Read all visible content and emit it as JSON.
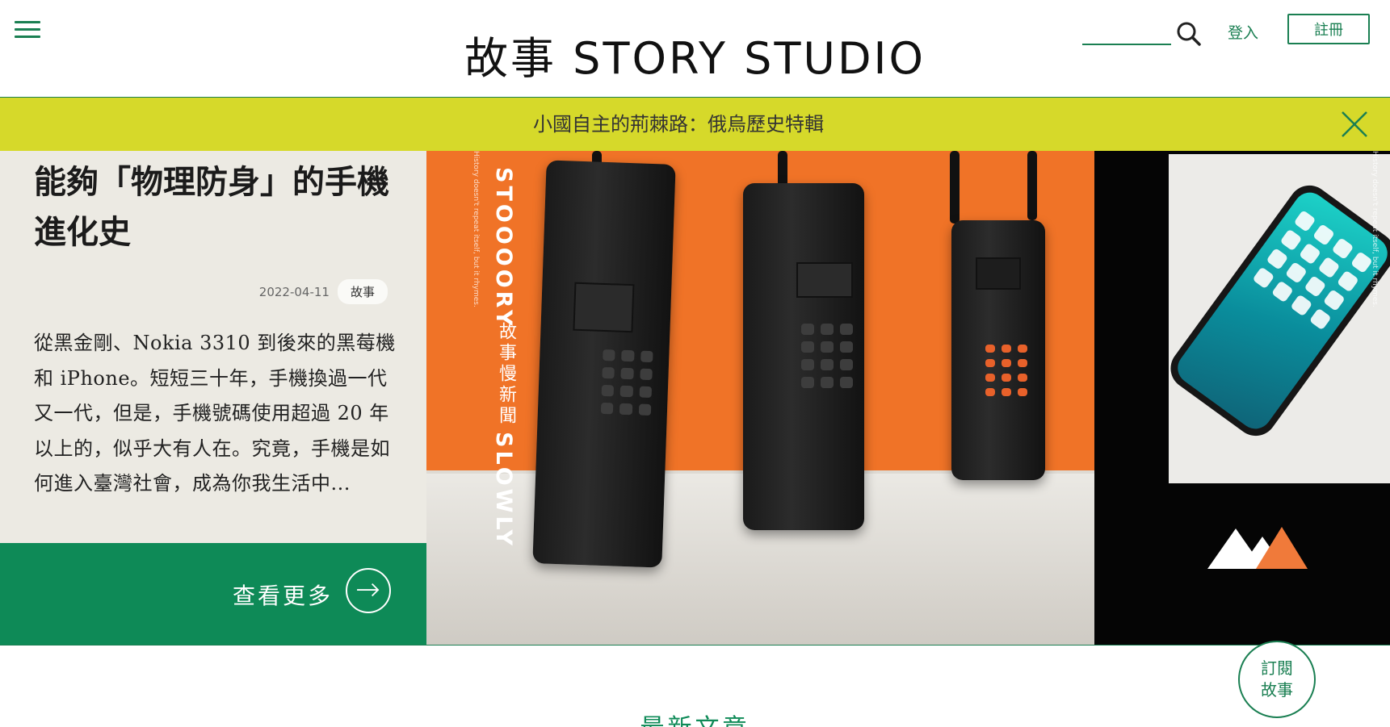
{
  "header": {
    "logo": "故事 STORY STUDIO",
    "login_label": "登入",
    "signup_label": "註冊",
    "search_placeholder": ""
  },
  "banner": {
    "text": "小國自主的荊棘路：俄烏歷史特輯"
  },
  "featured": {
    "title": "能夠「物理防身」的手機進化史",
    "date": "2022-04-11",
    "tag": "故事",
    "excerpt": "從黑金剛、Nokia 3310 到後來的黑莓機和 iPhone。短短三十年，手機換過一代又一代，但是，手機號碼使用超過 20 年以上的，似乎大有人在。究竟，手機是如何進入臺灣社會，成為你我生活中...",
    "more_label": "查看更多"
  },
  "hero_image": {
    "vertical_brand": "STOOOORY",
    "vertical_cn": "故事慢新聞",
    "vertical_slowly": "SLOWLY",
    "tagline": "History doesn't repeat itself, but it rhymes."
  },
  "subscribe": {
    "line1": "訂閱",
    "line2": "故事"
  },
  "section": {
    "title": "最新文章"
  },
  "colors": {
    "brand_green": "#0e8a57",
    "banner_yellow": "#d6d92a",
    "panel_beige": "#eceae3",
    "hero_orange": "#f07327"
  },
  "icons": [
    "menu-icon",
    "search-icon",
    "close-icon",
    "arrow-right-icon",
    "mountain-logo-icon"
  ]
}
